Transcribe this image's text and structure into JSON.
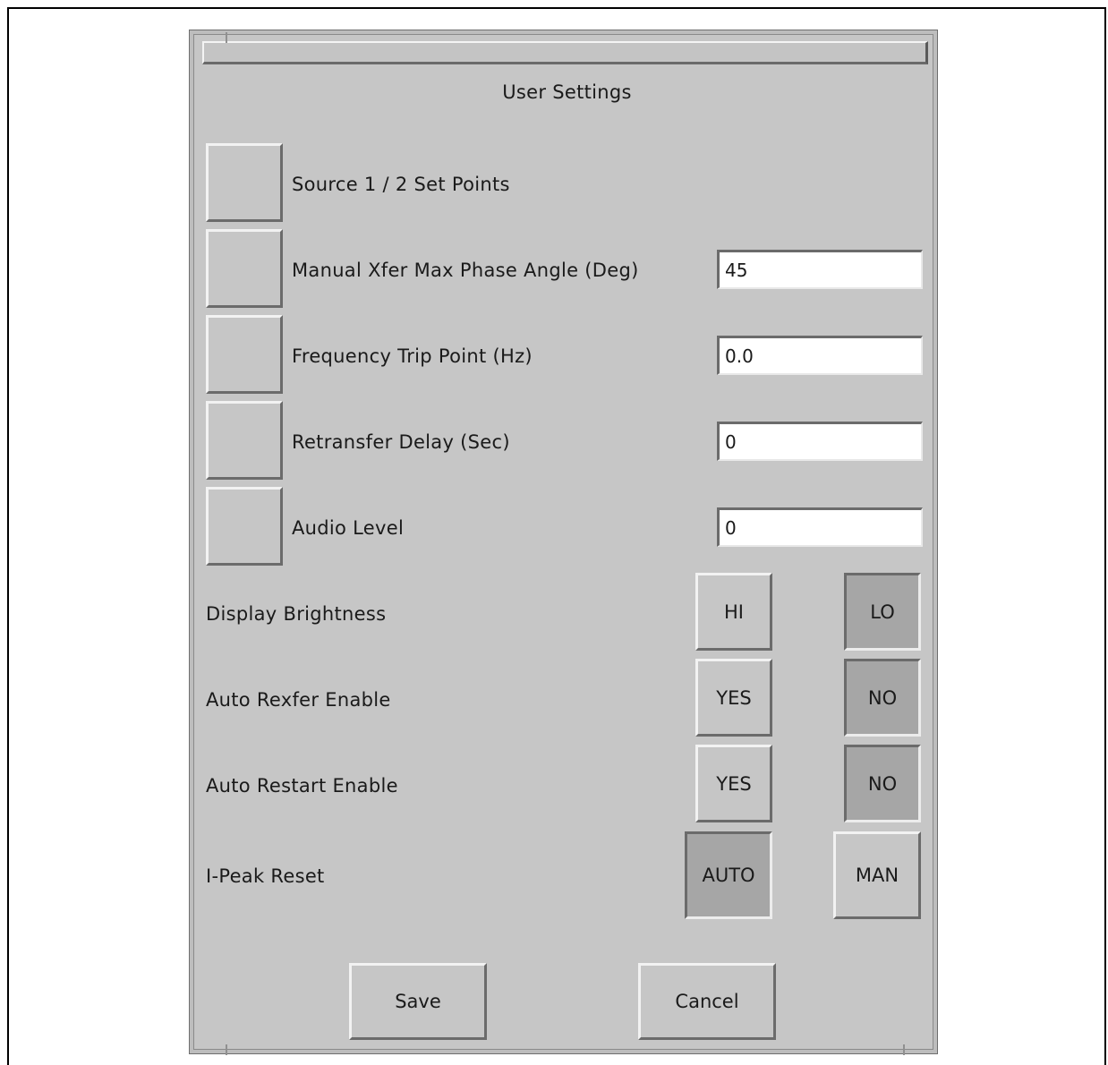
{
  "dialog": {
    "title": "User Settings"
  },
  "setpoints": [
    {
      "label": "Source 1 / 2 Set Points"
    },
    {
      "label": "Manual Xfer Max Phase Angle (Deg)",
      "value": "45"
    },
    {
      "label": "Frequency Trip Point (Hz)",
      "value": "0.0"
    },
    {
      "label": "Retransfer Delay (Sec)",
      "value": "0"
    },
    {
      "label": "Audio Level",
      "value": "0"
    }
  ],
  "options": [
    {
      "label": "Display Brightness",
      "left": "HI",
      "right": "LO",
      "selected": "LO"
    },
    {
      "label": "Auto Rexfer Enable",
      "left": "YES",
      "right": "NO",
      "selected": "NO"
    },
    {
      "label": "Auto Restart Enable",
      "left": "YES",
      "right": "NO",
      "selected": "NO"
    },
    {
      "label": "I-Peak Reset",
      "left": "AUTO",
      "right": "MAN",
      "selected": "AUTO"
    }
  ],
  "actions": {
    "save": "Save",
    "cancel": "Cancel"
  }
}
